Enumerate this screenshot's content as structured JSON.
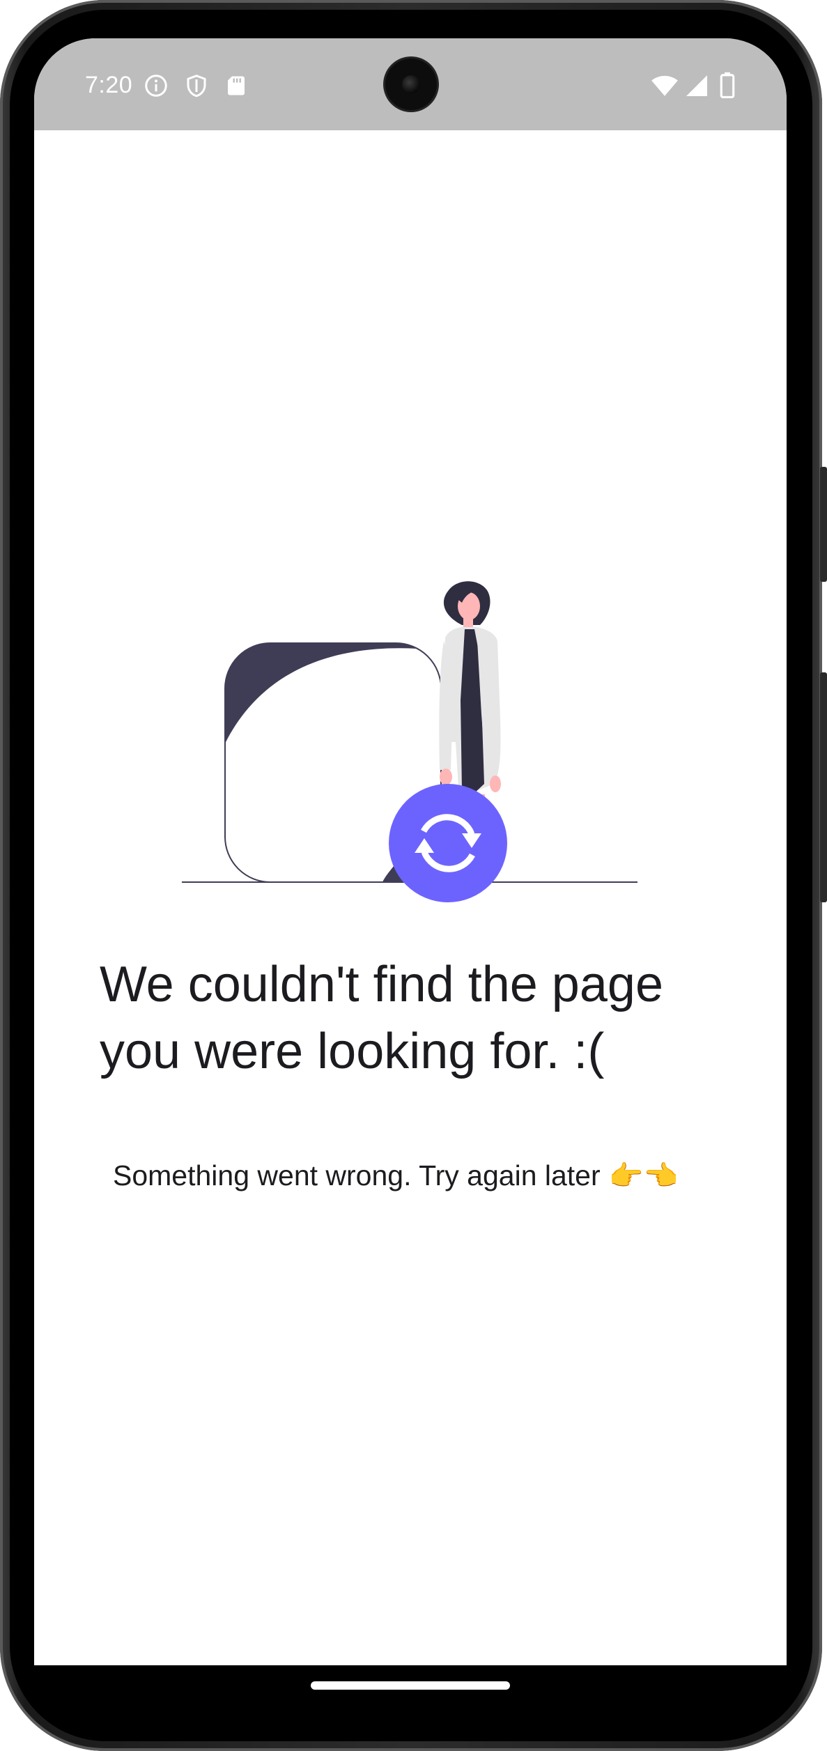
{
  "status_bar": {
    "time": "7:20",
    "icons_left": [
      "info-icon",
      "shield-icon",
      "sd-card-icon"
    ],
    "icons_right": [
      "wifi-icon",
      "signal-icon",
      "battery-icon"
    ]
  },
  "illustration": {
    "name": "woman-with-refresh-illustration",
    "accent_color": "#6c63ff",
    "dark_color": "#3f3d56"
  },
  "message": {
    "title": "We couldn't find the page you were looking for. :(",
    "subtitle": "Something went wrong. Try again later",
    "subtitle_emoji": "👉👈"
  }
}
